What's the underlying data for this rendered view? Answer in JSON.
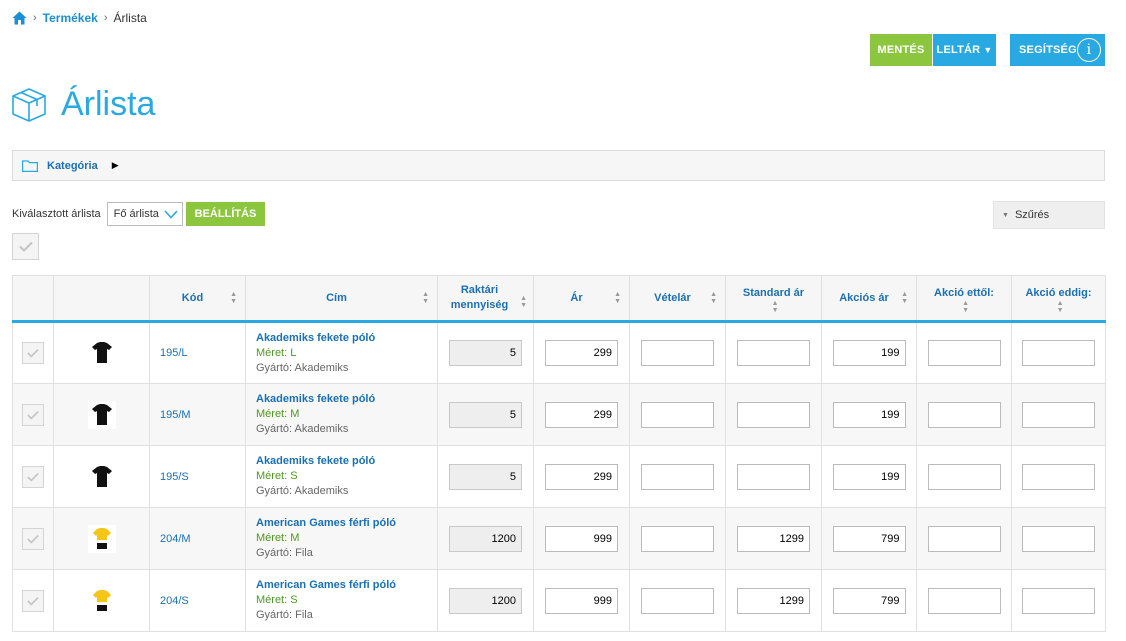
{
  "breadcrumb": {
    "parent": "Termékek",
    "current": "Árlista"
  },
  "toolbar": {
    "save_label": "MENTÉS",
    "inventory_label": "LELTÁR",
    "help_label": "SEGÍTSÉG"
  },
  "page": {
    "title": "Árlista"
  },
  "category": {
    "label": "Kategória"
  },
  "pricelist": {
    "label": "Kiválasztott árlista",
    "selected": "Fő árlista",
    "setup_label": "BEÁLLÍTÁS"
  },
  "filter": {
    "label": "Szűrés"
  },
  "colors": {
    "accent": "#29a9e1",
    "green": "#8cc63f",
    "link": "#1a6fb5"
  },
  "table": {
    "headers": {
      "code": "Kód",
      "title": "Cím",
      "stock": "Raktári mennyiség",
      "price": "Ár",
      "purchase": "Vételár",
      "standard": "Standard ár",
      "sale": "Akciós ár",
      "sale_from": "Akció ettől:",
      "sale_to": "Akció eddig:"
    },
    "rows": [
      {
        "code": "195/L",
        "name": "Akademiks fekete póló",
        "size": "Méret: L",
        "manufacturer": "Gyártó: Akademiks",
        "stock": "5",
        "price": "299",
        "purchase": "",
        "standard": "",
        "sale": "199",
        "sale_from": "",
        "sale_to": "",
        "thumb": "black-shirt-icon"
      },
      {
        "code": "195/M",
        "name": "Akademiks fekete póló",
        "size": "Méret: M",
        "manufacturer": "Gyártó: Akademiks",
        "stock": "5",
        "price": "299",
        "purchase": "",
        "standard": "",
        "sale": "199",
        "sale_from": "",
        "sale_to": "",
        "thumb": "black-shirt-icon"
      },
      {
        "code": "195/S",
        "name": "Akademiks fekete póló",
        "size": "Méret: S",
        "manufacturer": "Gyártó: Akademiks",
        "stock": "5",
        "price": "299",
        "purchase": "",
        "standard": "",
        "sale": "199",
        "sale_from": "",
        "sale_to": "",
        "thumb": "black-shirt-icon"
      },
      {
        "code": "204/M",
        "name": "American Games férfi póló",
        "size": "Méret: M",
        "manufacturer": "Gyártó: Fila",
        "stock": "1200",
        "price": "999",
        "purchase": "",
        "standard": "1299",
        "sale": "799",
        "sale_from": "",
        "sale_to": "",
        "thumb": "yellow-shirt-icon"
      },
      {
        "code": "204/S",
        "name": "American Games férfi póló",
        "size": "Méret: S",
        "manufacturer": "Gyártó: Fila",
        "stock": "1200",
        "price": "999",
        "purchase": "",
        "standard": "1299",
        "sale": "799",
        "sale_from": "",
        "sale_to": "",
        "thumb": "yellow-shirt-icon"
      }
    ]
  }
}
